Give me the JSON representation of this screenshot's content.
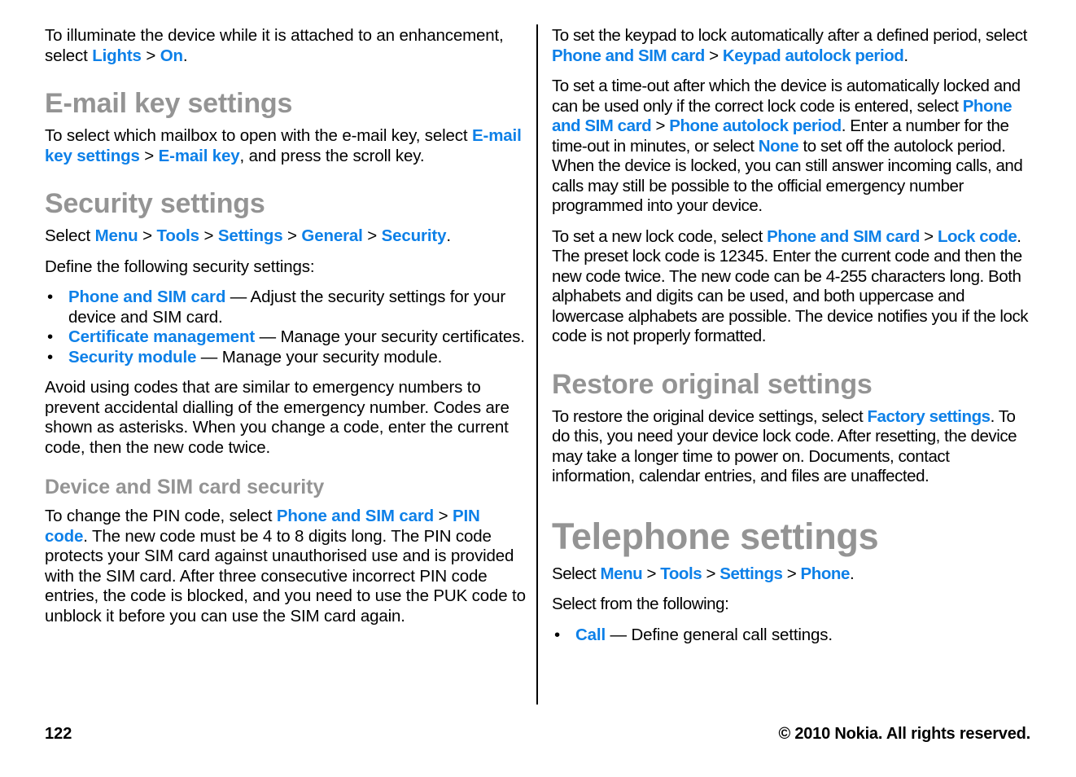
{
  "footer": {
    "page_number": "122",
    "copyright": "© 2010 Nokia. All rights reserved."
  },
  "left_column": {
    "intro_paragraph": {
      "part1": "To illuminate the device while it is attached to an enhancement, select ",
      "link1": "Lights",
      "sep1": ">",
      "link2": "On",
      "part2": "."
    },
    "email_key_section": {
      "heading": "E-mail key settings",
      "paragraph": {
        "part1": "To select which mailbox to open with the e-mail key, select ",
        "link1": "E-mail key settings",
        "sep1": ">",
        "link2": "E-mail key",
        "part2": ", and press the scroll key."
      }
    },
    "security_section": {
      "heading": "Security settings",
      "select_path": {
        "prefix": "Select ",
        "link1": "Menu",
        "sep1": ">",
        "link2": "Tools",
        "sep2": ">",
        "link3": "Settings",
        "sep3": ">",
        "link4": "General",
        "sep4": ">",
        "link5": "Security",
        "suffix": "."
      },
      "define_line": "Define the following security settings:",
      "bullets": [
        {
          "term": "Phone and SIM card",
          "dash": " — ",
          "desc": "Adjust the security settings for your device and SIM card."
        },
        {
          "term": "Certificate management",
          "dash": " — ",
          "desc": "Manage your security certificates."
        },
        {
          "term": "Security module",
          "dash": " — ",
          "desc": "Manage your security module."
        }
      ],
      "avoid_paragraph": "Avoid using codes that are similar to emergency numbers to prevent accidental dialling of the emergency number. Codes are shown as asterisks. When you change a code, enter the current code, then the new code twice."
    },
    "device_sim_section": {
      "heading": "Device and SIM card security",
      "paragraph": {
        "part1": "To change the PIN code, select ",
        "link1": "Phone and SIM card",
        "sep1": ">",
        "link2": "PIN code",
        "part2": ". The new code must be 4 to 8 digits long. The PIN code protects your SIM card against unauthorised use and is provided with the SIM card. After three consecutive incorrect PIN code entries, the code is blocked, and you need to use the PUK code to unblock it before you can use the SIM card again."
      }
    }
  },
  "right_column": {
    "keypad_paragraph": {
      "part1": "To set the keypad to lock automatically after a defined period, select ",
      "link1": "Phone and SIM card",
      "sep1": ">",
      "link2": "Keypad autolock period",
      "part2": "."
    },
    "timeout_paragraph": {
      "part1": "To set a time-out after which the device is automatically locked and can be used only if the correct lock code is entered, select ",
      "link1": "Phone and SIM card",
      "sep1": ">",
      "link2": "Phone autolock period",
      "part2": ". Enter a number for the time-out in minutes, or select ",
      "link3": "None",
      "part3": " to set off the autolock period. When the device is locked, you can still answer incoming calls, and calls may still be possible to the official emergency number programmed into your device."
    },
    "lockcode_paragraph": {
      "part1": "To set a new lock code, select ",
      "link1": "Phone and SIM card",
      "sep1": ">",
      "link2": "Lock code",
      "part2": ". The preset lock code is 12345. Enter the current code and then the new code twice. The new code can be 4-255 characters long. Both alphabets and digits can be used, and both uppercase and lowercase alphabets are possible. The device notifies you if the lock code is not properly formatted."
    },
    "restore_section": {
      "heading": "Restore original settings",
      "paragraph": {
        "part1": "To restore the original device settings, select ",
        "link1": "Factory settings",
        "part2": ". To do this, you need your device lock code. After resetting, the device may take a longer time to power on. Documents, contact information, calendar entries, and files are unaffected."
      }
    },
    "telephone_section": {
      "heading": "Telephone settings",
      "select_path": {
        "prefix": "Select ",
        "link1": "Menu",
        "sep1": ">",
        "link2": "Tools",
        "sep2": ">",
        "link3": "Settings",
        "sep3": ">",
        "link4": "Phone",
        "suffix": "."
      },
      "select_following": "Select from the following:",
      "bullets": [
        {
          "term": "Call",
          "dash": "  — ",
          "desc": "Define general call settings."
        }
      ]
    }
  },
  "colors": {
    "link_blue": "#0d80e8",
    "heading_gray": "#949494",
    "body_black": "#000000"
  }
}
